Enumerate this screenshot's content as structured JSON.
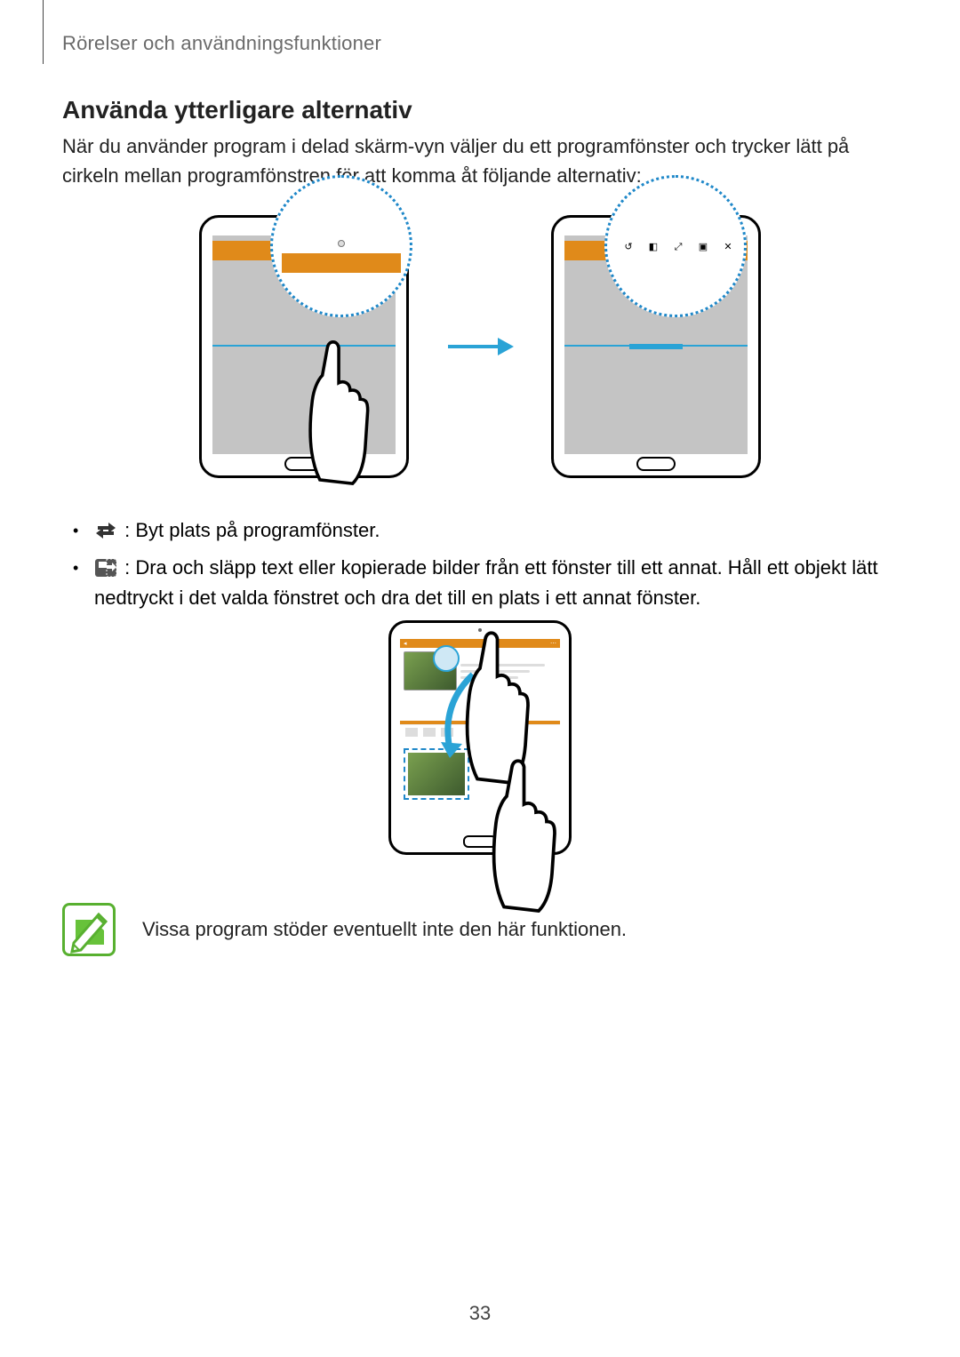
{
  "header": {
    "breadcrumb": "Rörelser och användningsfunktioner"
  },
  "section": {
    "heading": "Använda ytterligare alternativ",
    "intro": "När du använder program i delad skärm-vyn väljer du ett programfönster och trycker lätt på cirkeln mellan programfönstren för att komma åt följande alternativ:"
  },
  "bullets": [
    {
      "icon": "swap-icon",
      "text": " : Byt plats på programfönster."
    },
    {
      "icon": "drag-content-icon",
      "text": " : Dra och släpp text eller kopierade bilder från ett fönster till ett annat. Håll ett objekt lätt nedtryckt i det valda fönstret och dra det till en plats i ett annat fönster."
    }
  ],
  "note": {
    "text": "Vissa program stöder eventuellt inte den här funktionen."
  },
  "page_number": "33",
  "toolbar_icons": [
    "swap",
    "drag",
    "expand",
    "fullscreen",
    "close"
  ]
}
